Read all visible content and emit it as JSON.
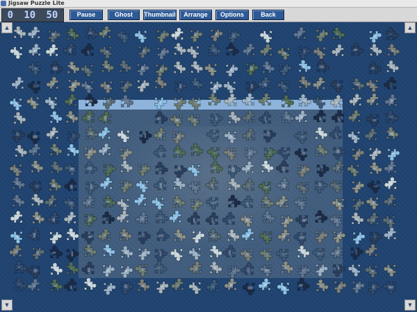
{
  "window": {
    "title": "Jigsaw Puzzle Lite"
  },
  "timer": {
    "hours": "0",
    "minutes": "10",
    "seconds": "50"
  },
  "toolbar": {
    "buttons": [
      {
        "label": "Pause"
      },
      {
        "label": "Ghost"
      },
      {
        "label": "Thumbnail"
      },
      {
        "label": "Arrange"
      },
      {
        "label": "Options"
      },
      {
        "label": "Back"
      }
    ]
  },
  "colors": {
    "board": "#1f426f",
    "button": "#2d5a96",
    "piece_palette": [
      "#2a3f5e",
      "#3d5a78",
      "#5b6d74",
      "#6e7d72",
      "#8a8f88",
      "#4f6b56",
      "#a7b4bc",
      "#324a6d",
      "#7a7e7a",
      "#9ab0c4",
      "#1b2c48",
      "#5f7590",
      "#c8d6dc",
      "#8bc0e4"
    ]
  },
  "icons": {
    "corner_tl": "expand-arrow-icon",
    "corner_tr": "expand-arrow-icon",
    "corner_bl": "expand-arrow-icon",
    "corner_br": "expand-arrow-icon"
  }
}
